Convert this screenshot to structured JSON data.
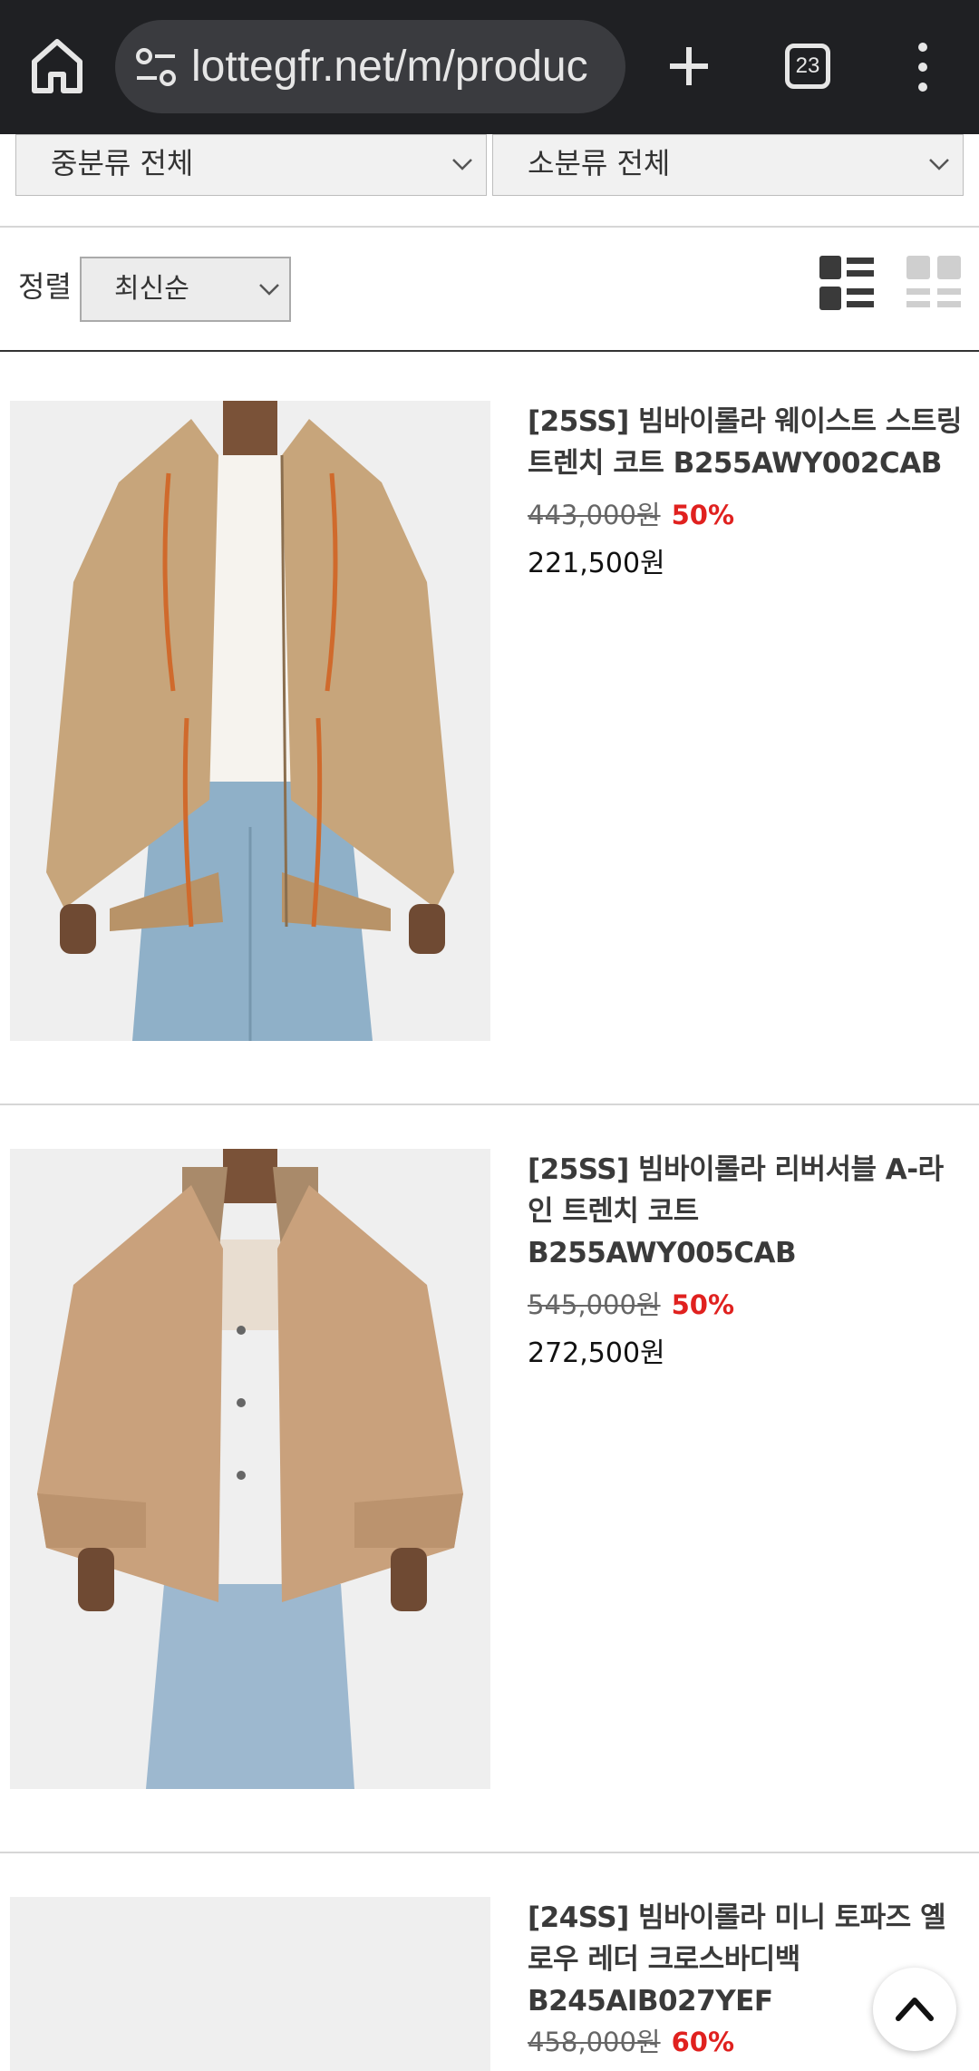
{
  "browser": {
    "url": "lottegfr.net/m/produc",
    "tab_count": "23"
  },
  "filters": {
    "middle_category": "중분류 전체",
    "sub_category": "소분류 전체",
    "sort_label": "정렬",
    "sort_value": "최신순"
  },
  "products": [
    {
      "name": "[25SS] 빔바이롤라 웨이스트 스트링 트렌치 코트 B255AWY002CAB",
      "original_price": "443,000원",
      "discount": "50%",
      "sale_price": "221,500원"
    },
    {
      "name": "[25SS] 빔바이롤라 리버서블 A-라인 트렌치 코트 B255AWY005CAB",
      "original_price": "545,000원",
      "discount": "50%",
      "sale_price": "272,500원"
    },
    {
      "name": "[24SS] 빔바이롤라 미니 토파즈 옐로우 레더 크로스바디백 B245AIB027YEF",
      "original_price": "458,000원",
      "discount": "60%",
      "sale_price": ""
    }
  ],
  "colors": {
    "chrome_bg": "#1f2023",
    "discount_red": "#e0211f"
  },
  "icons": [
    "home-icon",
    "site-settings-icon",
    "new-tab-icon",
    "tab-switcher-icon",
    "more-menu-icon",
    "chevron-down-icon",
    "list-view-icon",
    "grid-view-icon",
    "scroll-top-icon"
  ]
}
